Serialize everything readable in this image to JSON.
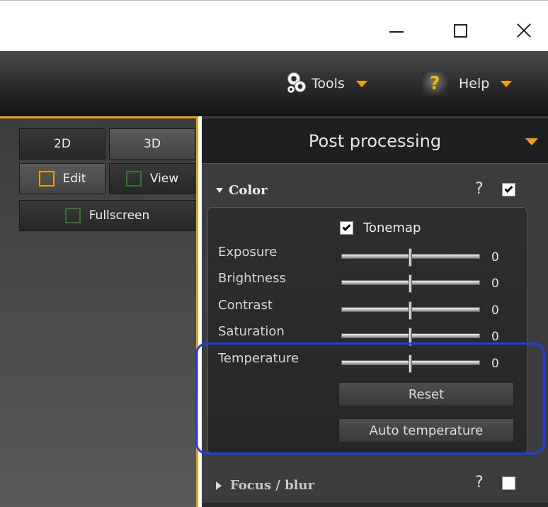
{
  "window": {
    "minimize_icon": "minimize-icon",
    "maximize_icon": "maximize-icon",
    "close_icon": "close-icon"
  },
  "menubar": {
    "tools_label": "Tools",
    "tools_icon": "gears-icon",
    "help_label": "Help",
    "help_icon": "question-icon",
    "help_glyph": "?",
    "accent": "#f5a000"
  },
  "left_panel": {
    "btn_2d": "2D",
    "btn_3d": "3D",
    "btn_edit": "Edit",
    "btn_view": "View",
    "btn_fullscreen": "Fullscreen",
    "border_color": "#f0a000"
  },
  "post_processing": {
    "title": "Post processing",
    "color_section": {
      "title": "Color",
      "help": "?",
      "enabled": true,
      "tonemap_label": "Tonemap",
      "tonemap_checked": true,
      "sliders": [
        {
          "label": "Exposure",
          "value": "0",
          "position": 0.5
        },
        {
          "label": "Brightness",
          "value": "0",
          "position": 0.5
        },
        {
          "label": "Contrast",
          "value": "0",
          "position": 0.5
        },
        {
          "label": "Saturation",
          "value": "0",
          "position": 0.5
        },
        {
          "label": "Temperature",
          "value": "0",
          "position": 0.5
        }
      ],
      "reset_label": "Reset",
      "auto_temperature_label": "Auto temperature"
    },
    "focus_section": {
      "title": "Focus / blur",
      "help": "?",
      "enabled": false
    }
  },
  "highlight_color": "#1a3fe6"
}
